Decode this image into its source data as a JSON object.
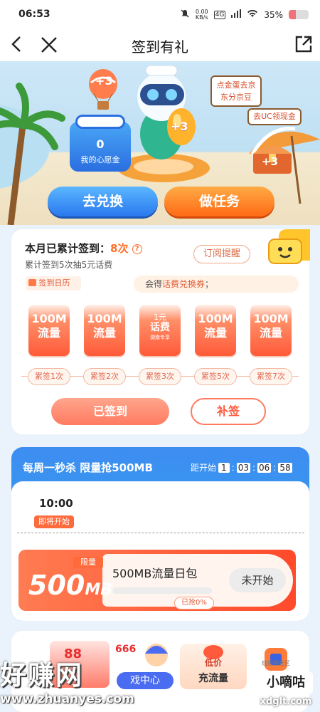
{
  "status": {
    "time": "06:53",
    "net_speed": "0.00",
    "net_unit": "KB/s",
    "signal": "4G",
    "battery": "35%",
    "battery_level": 0.35
  },
  "nav": {
    "title": "签到有礼"
  },
  "hero": {
    "wish_value": "0",
    "wish_label": "我的心愿金",
    "balloon_badge": "+3",
    "egg_badge": "+3",
    "chest_badge": "+3",
    "sign_jd": "点金蛋去京东分京豆",
    "sign_uc": "去UC领现金",
    "exchange_btn": "去兑换",
    "task_btn": "做任务"
  },
  "checkin": {
    "title": "本月已累计签到：",
    "count": "8次",
    "subtitle": "累计签到5次抽5元话费",
    "subscribe": "订阅提醒",
    "calendar": "签到日历",
    "coupon_prefix": "会得",
    "coupon_highlight": "话费兑换券",
    "coupon_suffix": "；",
    "gifts": [
      {
        "l1": "100M",
        "l2": "流量"
      },
      {
        "l1": "100M",
        "l2": "流量"
      },
      {
        "l1": "1元",
        "l2": "话费",
        "l3": "湖南专享"
      },
      {
        "l1": "100M",
        "l2": "流量"
      },
      {
        "l1": "100M",
        "l2": "流量"
      }
    ],
    "steps": [
      "累签1次",
      "累签2次",
      "累签3次",
      "累签5次",
      "累签7次"
    ],
    "signed_btn": "已签到",
    "makeup_btn": "补签"
  },
  "flash": {
    "title": "每周一秒杀 限量抢500MB",
    "countdown_label": "距开始",
    "countdown": [
      "1",
      "03",
      "06",
      "58"
    ],
    "time": "10:00",
    "status": "即将开始",
    "limit_tag": "限量",
    "big_amount": "500",
    "big_unit": "MB",
    "product": "500MB流量日包",
    "progress_label": "已抢0%",
    "progress": 0,
    "btn": "未开始"
  },
  "bottom": {
    "item1_num": "88",
    "item2_num": "666",
    "item2_label": "戏中心",
    "item3_top": "低价",
    "item3_label": "充流量",
    "item4_label": "线报酷社区"
  },
  "watermark": {
    "site": "好赚网",
    "url": "www.zhuanyes.com",
    "brand": "小嘀咕",
    "brand_url": "xdglt.com"
  }
}
